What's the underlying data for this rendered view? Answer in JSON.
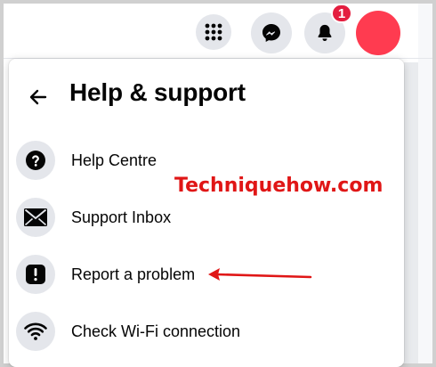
{
  "topbar": {
    "notifications_badge": "1",
    "icons": [
      "menu-grid-icon",
      "messenger-icon",
      "bell-icon"
    ],
    "avatar_color": "#ff3b50"
  },
  "panel": {
    "title": "Help & support",
    "back_icon": "back-arrow-icon",
    "items": [
      {
        "label": "Help Centre",
        "icon": "question-icon"
      },
      {
        "label": "Support Inbox",
        "icon": "envelope-icon"
      },
      {
        "label": "Report a problem",
        "icon": "exclamation-icon"
      },
      {
        "label": "Check Wi-Fi connection",
        "icon": "wifi-icon"
      }
    ]
  },
  "watermark": "Techniquehow.com",
  "colors": {
    "annotation_red": "#e01616",
    "icon_bg": "#e4e6eb",
    "badge_red": "#e41e3f"
  }
}
